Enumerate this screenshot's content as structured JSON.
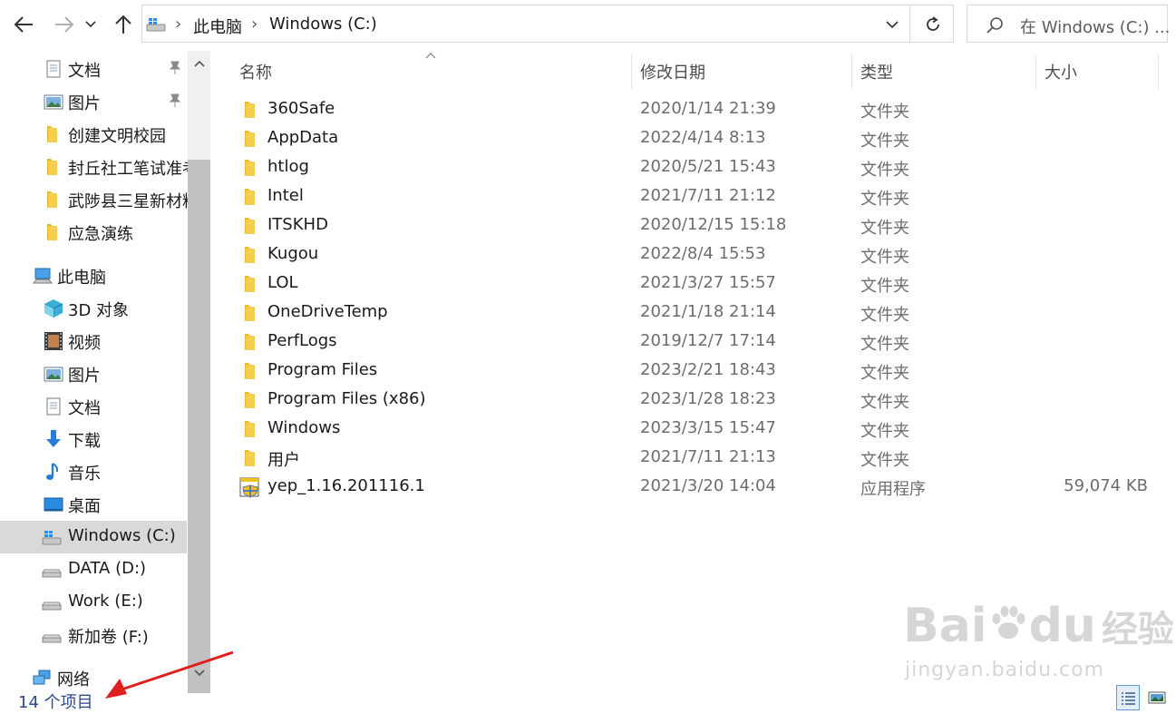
{
  "toolbar": {
    "back_icon": "arrow-left-icon",
    "forward_icon": "arrow-right-icon",
    "recent_icon": "chevron-down-icon",
    "up_icon": "arrow-up-icon",
    "refresh_icon": "refresh-icon"
  },
  "address": {
    "crumbs": [
      "此电脑",
      "Windows (C:)"
    ]
  },
  "search": {
    "placeholder": "在 Windows (C:) ..."
  },
  "nav": {
    "quick_access": [
      {
        "label": "文档",
        "icon": "document-icon",
        "pinned": true
      },
      {
        "label": "图片",
        "icon": "pictures-icon",
        "pinned": true
      },
      {
        "label": "创建文明校园",
        "icon": "folder-icon",
        "pinned": false
      },
      {
        "label": "封丘社工笔试准考",
        "icon": "folder-icon",
        "pinned": false
      },
      {
        "label": "武陟县三星新材料",
        "icon": "folder-icon",
        "pinned": false
      },
      {
        "label": "应急演练",
        "icon": "folder-icon",
        "pinned": false
      }
    ],
    "this_pc": {
      "label": "此电脑",
      "icon": "computer-icon"
    },
    "pc_items": [
      {
        "label": "3D 对象",
        "icon": "3d-objects-icon"
      },
      {
        "label": "视频",
        "icon": "video-icon"
      },
      {
        "label": "图片",
        "icon": "pictures-icon"
      },
      {
        "label": "文档",
        "icon": "document-icon"
      },
      {
        "label": "下载",
        "icon": "download-icon"
      },
      {
        "label": "音乐",
        "icon": "music-icon"
      },
      {
        "label": "桌面",
        "icon": "desktop-icon"
      },
      {
        "label": "Windows (C:)",
        "icon": "windows-drive-icon",
        "selected": true
      },
      {
        "label": "DATA (D:)",
        "icon": "drive-icon"
      },
      {
        "label": "Work (E:)",
        "icon": "drive-icon"
      },
      {
        "label": "新加卷 (F:)",
        "icon": "drive-icon"
      }
    ],
    "network": {
      "label": "网络",
      "icon": "network-icon"
    }
  },
  "columns": {
    "name": "名称",
    "date": "修改日期",
    "type": "类型",
    "size": "大小"
  },
  "files": [
    {
      "name": "360Safe",
      "date": "2020/1/14 21:39",
      "type": "文件夹",
      "size": "",
      "icon": "folder-icon"
    },
    {
      "name": "AppData",
      "date": "2022/4/14 8:13",
      "type": "文件夹",
      "size": "",
      "icon": "folder-icon"
    },
    {
      "name": "htlog",
      "date": "2020/5/21 15:43",
      "type": "文件夹",
      "size": "",
      "icon": "folder-icon"
    },
    {
      "name": "Intel",
      "date": "2021/7/11 21:12",
      "type": "文件夹",
      "size": "",
      "icon": "folder-icon"
    },
    {
      "name": "ITSKHD",
      "date": "2020/12/15 15:18",
      "type": "文件夹",
      "size": "",
      "icon": "folder-icon"
    },
    {
      "name": "Kugou",
      "date": "2022/8/4 15:53",
      "type": "文件夹",
      "size": "",
      "icon": "folder-icon"
    },
    {
      "name": "LOL",
      "date": "2021/3/27 15:57",
      "type": "文件夹",
      "size": "",
      "icon": "folder-icon"
    },
    {
      "name": "OneDriveTemp",
      "date": "2021/1/18 21:14",
      "type": "文件夹",
      "size": "",
      "icon": "folder-icon"
    },
    {
      "name": "PerfLogs",
      "date": "2019/12/7 17:14",
      "type": "文件夹",
      "size": "",
      "icon": "folder-icon"
    },
    {
      "name": "Program Files",
      "date": "2023/2/21 18:43",
      "type": "文件夹",
      "size": "",
      "icon": "folder-icon"
    },
    {
      "name": "Program Files (x86)",
      "date": "2023/1/28 18:23",
      "type": "文件夹",
      "size": "",
      "icon": "folder-icon"
    },
    {
      "name": "Windows",
      "date": "2023/3/15 15:47",
      "type": "文件夹",
      "size": "",
      "icon": "folder-icon"
    },
    {
      "name": "用户",
      "date": "2021/7/11 21:13",
      "type": "文件夹",
      "size": "",
      "icon": "folder-icon"
    },
    {
      "name": "yep_1.16.201116.1",
      "date": "2021/3/20 14:04",
      "type": "应用程序",
      "size": "59,074 KB",
      "icon": "application-icon"
    }
  ],
  "status": {
    "item_count": "14 个项目"
  },
  "view_buttons": {
    "details_icon": "details-view-icon",
    "tiles_icon": "large-icons-view-icon"
  },
  "watermark": {
    "brand_a": "Bai",
    "brand_b": "du",
    "brand_cn": "经验",
    "url": "jingyan.baidu.com"
  },
  "colors": {
    "folder": "#f0c040",
    "selection": "#d9d9d9",
    "status_text": "#2b4a8b",
    "arrow": "#e02020"
  }
}
